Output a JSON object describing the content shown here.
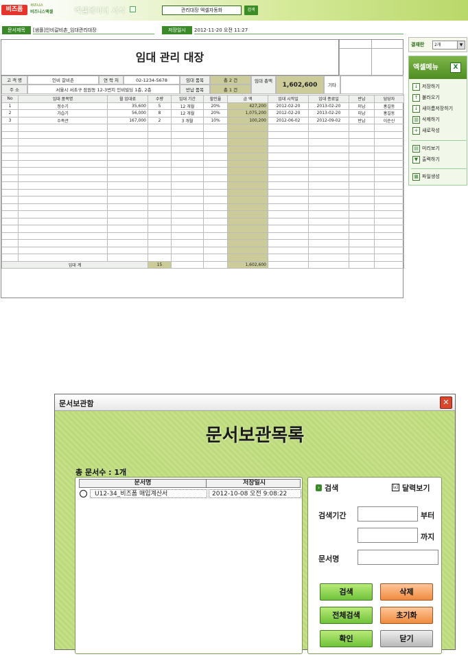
{
  "topbar": {
    "logo_primary": "비즈폼",
    "logo_secondary_small": "비즈니스",
    "logo_secondary": "비즈니스액셀",
    "title": "엑셀데이터 서식",
    "search_value": "관리대장 엑셀자동화",
    "search_button": "검색"
  },
  "docinfo": {
    "title_label": "문서제목",
    "title_value": "[샘플]인비갈비촌_임대관리대장",
    "saved_label": "저장일시",
    "saved_value": "2012-11-20  오전 11:27"
  },
  "sheet": {
    "title": "임대 관리 대장",
    "info": {
      "customer_label": "고 객 명",
      "customer_value": "인비 갈비촌",
      "contact_label": "연 락 처",
      "contact_value": "02-1234-5678",
      "address_label": "주     소",
      "address_value": "서울시 서초구 잠원동 12-3번지 인비빌딩 1층, 2층",
      "rent_items_label": "임대 품목",
      "rent_items_value": "총  2  건",
      "return_items_label": "반납 품목",
      "return_items_value": "총  1  건",
      "total_label": "임대 총액",
      "total_value": "1,602,600",
      "etc_label": "기타"
    },
    "columns": [
      "No",
      "임대 품목명",
      "월 임대료",
      "수량",
      "임대 기간",
      "할인율",
      "금    액",
      "임대 시작일",
      "임대 종료일",
      "반납",
      "담당자"
    ],
    "rows": [
      [
        "1",
        "정수기",
        "35,600",
        "5",
        "12 개월",
        "20%",
        "427,200",
        "2012-02-20",
        "2013-02-20",
        "미납",
        "홍길동"
      ],
      [
        "2",
        "가습기",
        "56,000",
        "8",
        "12 개월",
        "20%",
        "1,075,200",
        "2012-02-20",
        "2013-02-20",
        "미납",
        "홍길동"
      ],
      [
        "3",
        "수족관",
        "167,000",
        "2",
        "3 개월",
        "10%",
        "100,200",
        "2012-06-02",
        "2012-09-02",
        "반납",
        "이순신"
      ]
    ],
    "footer": {
      "label": "임대 계",
      "qty": "15",
      "amount": "1,602,600"
    }
  },
  "right_menu": {
    "approval_label": "결재란",
    "approval_value": "2개",
    "menu_title": "엑셀메뉴",
    "menu_icon": "excel-icon",
    "items": [
      "저장하기",
      "불러오기",
      "새이름저장하기",
      "삭제하기",
      "새로작성",
      "미리보기",
      "출력하기",
      "파일생성"
    ]
  },
  "dialog": {
    "title": "문서보관함",
    "close_symbol": "✕",
    "heading": "문서보관목록",
    "doc_count": "총 문서수 : 1개",
    "list_headers": [
      "문서명",
      "저장일시"
    ],
    "list_rows": [
      {
        "name": "U12-34_비즈폼 매입계산서",
        "date": "2012-10-08 오전 9:08:22"
      }
    ],
    "search": {
      "title": "검색",
      "calendar_label": "달력보기",
      "calendar_checked": "☑",
      "period_label": "검색기간",
      "from_suffix": "부터",
      "to_suffix": "까지",
      "docname_label": "문서명",
      "from_value": "",
      "to_value": "",
      "docname_value": ""
    },
    "buttons": {
      "search": "검색",
      "delete": "삭제",
      "search_all": "전체검색",
      "reset": "초기화",
      "confirm": "확인",
      "close": "닫기"
    }
  }
}
